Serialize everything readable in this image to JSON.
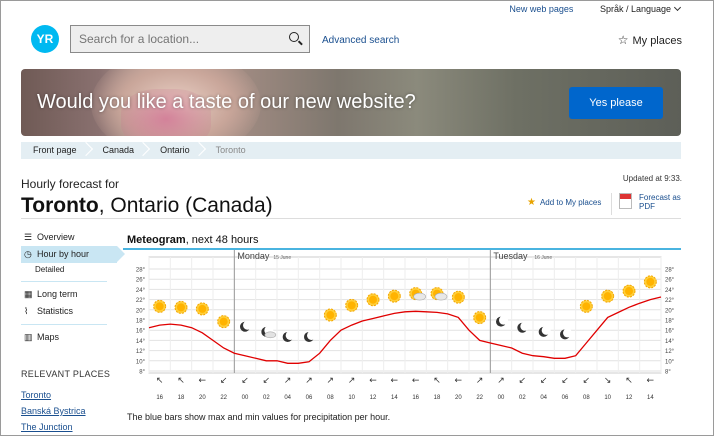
{
  "top": {
    "new_pages": "New web pages",
    "language": "Språk / Language"
  },
  "logo": "YR",
  "search": {
    "placeholder": "Search for a location..."
  },
  "advanced_search": "Advanced search",
  "my_places": "My places",
  "banner": {
    "text": "Would you like a taste of our new website?",
    "button": "Yes please"
  },
  "breadcrumb": [
    "Front page",
    "Canada",
    "Ontario",
    "Toronto"
  ],
  "updated": "Updated at 9:33.",
  "heading": {
    "pre": "Hourly forecast for",
    "city": "Toronto",
    "region": ", Ontario (Canada)"
  },
  "actions": {
    "add_my_places": "Add to My places",
    "pdf_line1": "Forecast as",
    "pdf_line2": "PDF"
  },
  "nav": {
    "overview": "Overview",
    "hour_by_hour": "Hour by hour",
    "detailed": "Detailed",
    "long_term": "Long term",
    "statistics": "Statistics",
    "maps": "Maps"
  },
  "relevant": {
    "title": "RELEVANT PLACES",
    "items": [
      "Toronto",
      "Banská Bystrica",
      "The Junction"
    ]
  },
  "meteogram": {
    "title_bold": "Meteogram",
    "title_rest": ", next 48 hours",
    "days": [
      {
        "name": "Monday",
        "date": "15 June"
      },
      {
        "name": "Tuesday",
        "date": "16 June"
      }
    ],
    "note": "The blue bars show max and min values for precipitation per hour."
  },
  "chart_data": {
    "type": "line",
    "title": "Meteogram, next 48 hours",
    "y_ticks": [
      "8°",
      "10°",
      "12°",
      "14°",
      "16°",
      "18°",
      "20°",
      "22°",
      "24°",
      "26°",
      "28°"
    ],
    "ylim": [
      8,
      28
    ],
    "x_tick_labels": [
      "16",
      "18",
      "20",
      "22",
      "00",
      "02",
      "04",
      "06",
      "08",
      "10",
      "12",
      "14",
      "16",
      "18",
      "20",
      "22",
      "00",
      "02",
      "04",
      "06",
      "08",
      "10",
      "12",
      "14"
    ],
    "series": [
      {
        "color": "#e00000",
        "x": [
          15,
          16,
          17,
          18,
          19,
          20,
          21,
          22,
          23,
          0,
          1,
          2,
          3,
          4,
          5,
          6,
          7,
          8,
          9,
          10,
          11,
          12,
          13,
          14,
          15,
          16,
          17,
          18,
          19,
          20,
          21,
          22,
          23,
          0,
          1,
          2,
          3,
          4,
          5,
          6,
          7,
          8,
          9,
          10,
          11,
          12,
          13,
          14,
          15
        ],
        "values": [
          16.5,
          17,
          17.2,
          17,
          16.5,
          15.5,
          14,
          12.5,
          11.5,
          11,
          10.5,
          10,
          10,
          9.5,
          9.5,
          9.8,
          11.5,
          14,
          16,
          17,
          17.8,
          18.3,
          18.8,
          19.3,
          19.6,
          19.7,
          19.6,
          19.5,
          19.2,
          18.5,
          16,
          14,
          13.5,
          13,
          12.5,
          11.5,
          11,
          10.8,
          10.5,
          10.5,
          11,
          13.5,
          16,
          18.5,
          19.5,
          20.5,
          21.3,
          22,
          22.5
        ]
      }
    ],
    "symbols": [
      {
        "x": 16,
        "icon": "sun",
        "temp": 19.5
      },
      {
        "x": 17,
        "icon": "sun",
        "temp": 19.3
      },
      {
        "x": 18,
        "icon": "sun",
        "temp": 19
      },
      {
        "x": 19,
        "icon": "sun",
        "temp": 16.5
      },
      {
        "x": 20,
        "icon": "moon",
        "temp": 15.5
      },
      {
        "x": 21,
        "icon": "moon-cloud",
        "temp": 14.5
      },
      {
        "x": 22,
        "icon": "moon",
        "temp": 13.5
      },
      {
        "x": 23,
        "icon": "moon",
        "temp": 13.5
      },
      {
        "x": 0,
        "icon": "sun",
        "temp": 17.8
      },
      {
        "x": 1,
        "icon": "sun",
        "temp": 19.7
      },
      {
        "x": 2,
        "icon": "sun",
        "temp": 20.8
      },
      {
        "x": 3,
        "icon": "sun",
        "temp": 21.5
      },
      {
        "x": 4,
        "icon": "sun-cloud",
        "temp": 22
      },
      {
        "x": 5,
        "icon": "sun-cloud",
        "temp": 22
      },
      {
        "x": 6,
        "icon": "sun",
        "temp": 21.3
      },
      {
        "x": 7,
        "icon": "sun",
        "temp": 17.3
      },
      {
        "x": 8,
        "icon": "moon",
        "temp": 16.5
      },
      {
        "x": 9,
        "icon": "moon",
        "temp": 15.3
      },
      {
        "x": 10,
        "icon": "moon",
        "temp": 14.5
      },
      {
        "x": 11,
        "icon": "moon",
        "temp": 14
      },
      {
        "x": 12,
        "icon": "sun",
        "temp": 19.5
      },
      {
        "x": 13,
        "icon": "sun",
        "temp": 21.5
      },
      {
        "x": 14,
        "icon": "sun",
        "temp": 22.5
      },
      {
        "x": 15,
        "icon": "sun",
        "temp": 24.3
      }
    ],
    "wind_arrows": [
      "↖",
      "↖",
      "←",
      "↙",
      "↙",
      "↙",
      "↗",
      "↗",
      "↗",
      "↗",
      "←",
      "←",
      "←",
      "↖",
      "←",
      "↗",
      "↗",
      "↙",
      "↙",
      "↙",
      "↙",
      "↘",
      "↖",
      "←"
    ],
    "grid": true
  }
}
